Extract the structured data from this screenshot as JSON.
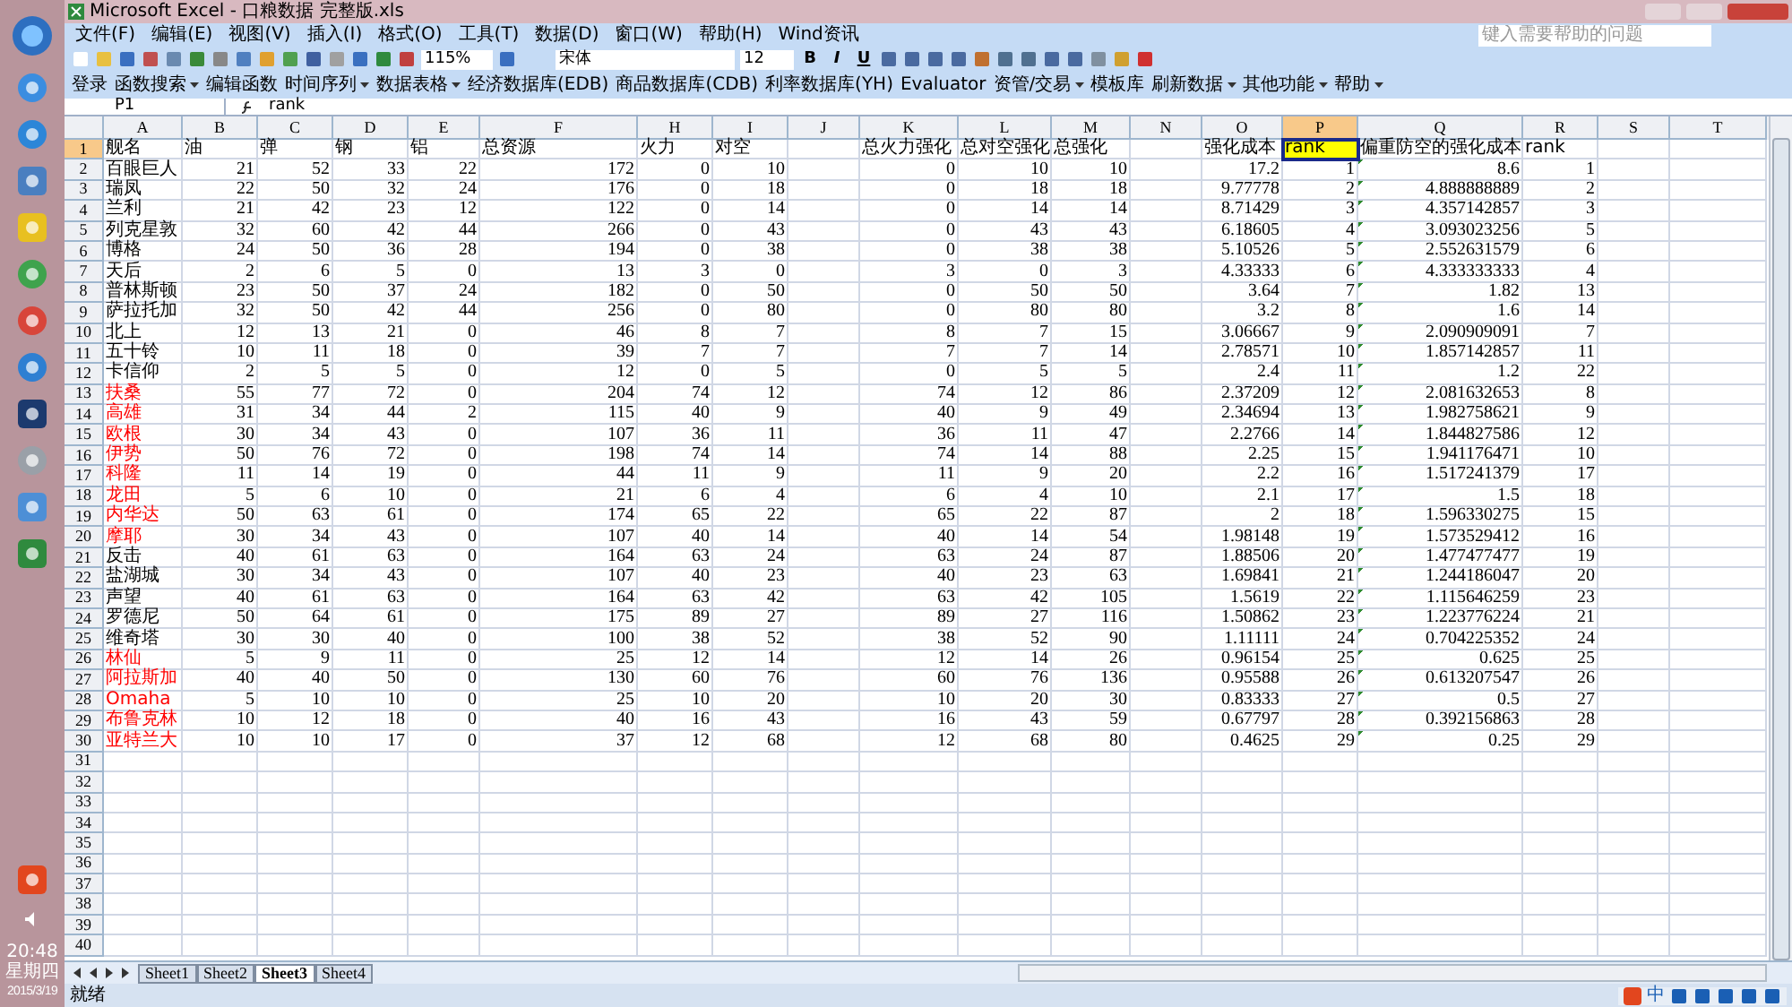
{
  "window": {
    "title": "Microsoft Excel - 口粮数据 完整版.xls"
  },
  "menu": [
    "文件(F)",
    "编辑(E)",
    "视图(V)",
    "插入(I)",
    "格式(O)",
    "工具(T)",
    "数据(D)",
    "窗口(W)",
    "帮助(H)",
    "Wind资讯"
  ],
  "help_field": {
    "placeholder": "键入需要帮助的问题"
  },
  "toolbar": {
    "zoom": "115%",
    "font": "宋体",
    "size": "12",
    "format_buttons": [
      "B",
      "I",
      "U"
    ]
  },
  "addin_toolbar": [
    {
      "label": "登录",
      "dropdown": false
    },
    {
      "label": "函数搜索",
      "dropdown": true
    },
    {
      "label": "编辑函数",
      "dropdown": false
    },
    {
      "label": "时间序列",
      "dropdown": true
    },
    {
      "label": "数据表格",
      "dropdown": true
    },
    {
      "label": "经济数据库(EDB)",
      "dropdown": false
    },
    {
      "label": "商品数据库(CDB)",
      "dropdown": false
    },
    {
      "label": "利率数据库(YH)",
      "dropdown": false
    },
    {
      "label": "Evaluator",
      "dropdown": false
    },
    {
      "label": "资管/交易",
      "dropdown": true
    },
    {
      "label": "模板库",
      "dropdown": false
    },
    {
      "label": "刷新数据",
      "dropdown": true
    },
    {
      "label": "其他功能",
      "dropdown": true
    },
    {
      "label": "帮助",
      "dropdown": true
    }
  ],
  "formula_bar": {
    "name_box": "P1",
    "value": "rank"
  },
  "columns": [
    {
      "letter": "A",
      "selected": false
    },
    {
      "letter": "B",
      "selected": false
    },
    {
      "letter": "C",
      "selected": false
    },
    {
      "letter": "D",
      "selected": false
    },
    {
      "letter": "E",
      "selected": false
    },
    {
      "letter": "F",
      "selected": false
    },
    {
      "letter": "H",
      "selected": false
    },
    {
      "letter": "I",
      "selected": false
    },
    {
      "letter": "J",
      "selected": false
    },
    {
      "letter": "K",
      "selected": false
    },
    {
      "letter": "L",
      "selected": false
    },
    {
      "letter": "M",
      "selected": false
    },
    {
      "letter": "N",
      "selected": false
    },
    {
      "letter": "O",
      "selected": false
    },
    {
      "letter": "P",
      "selected": true
    },
    {
      "letter": "Q",
      "selected": false
    },
    {
      "letter": "R",
      "selected": false
    },
    {
      "letter": "S",
      "selected": false
    },
    {
      "letter": "T",
      "selected": false
    }
  ],
  "rows": [
    {
      "number": "1",
      "selected": true,
      "cells": [
        "舰名",
        "油",
        "弹",
        "钢",
        "铝",
        "总资源",
        "火力",
        "对空",
        null,
        "总火力强化",
        "总对空强化",
        "总强化",
        null,
        "强化成本",
        "rank",
        "偏重防空的强化成本",
        "rank",
        null,
        null
      ]
    },
    {
      "number": "2",
      "selected": false,
      "color": "#000000",
      "flagged": true,
      "cells": [
        "百眼巨人",
        "21",
        "52",
        "33",
        "22",
        "172",
        "0",
        "10",
        null,
        "0",
        "10",
        "10",
        null,
        "17.2",
        "1",
        "8.6",
        "1",
        null,
        null
      ]
    },
    {
      "number": "3",
      "selected": false,
      "color": "#000000",
      "flagged": true,
      "cells": [
        "瑞凤",
        "22",
        "50",
        "32",
        "24",
        "176",
        "0",
        "18",
        null,
        "0",
        "18",
        "18",
        null,
        "9.77778",
        "2",
        "4.888888889",
        "2",
        null,
        null
      ]
    },
    {
      "number": "4",
      "selected": false,
      "color": "#000000",
      "flagged": true,
      "cells": [
        "兰利",
        "21",
        "42",
        "23",
        "12",
        "122",
        "0",
        "14",
        null,
        "0",
        "14",
        "14",
        null,
        "8.71429",
        "3",
        "4.357142857",
        "3",
        null,
        null
      ]
    },
    {
      "number": "5",
      "selected": false,
      "color": "#000000",
      "flagged": true,
      "cells": [
        "列克星敦",
        "32",
        "60",
        "42",
        "44",
        "266",
        "0",
        "43",
        null,
        "0",
        "43",
        "43",
        null,
        "6.18605",
        "4",
        "3.093023256",
        "5",
        null,
        null
      ]
    },
    {
      "number": "6",
      "selected": false,
      "color": "#000000",
      "flagged": true,
      "cells": [
        "博格",
        "24",
        "50",
        "36",
        "28",
        "194",
        "0",
        "38",
        null,
        "0",
        "38",
        "38",
        null,
        "5.10526",
        "5",
        "2.552631579",
        "6",
        null,
        null
      ]
    },
    {
      "number": "7",
      "selected": false,
      "color": "#000000",
      "flagged": true,
      "cells": [
        "天后",
        "2",
        "6",
        "5",
        "0",
        "13",
        "3",
        "0",
        null,
        "3",
        "0",
        "3",
        null,
        "4.33333",
        "6",
        "4.333333333",
        "4",
        null,
        null
      ]
    },
    {
      "number": "8",
      "selected": false,
      "color": "#000000",
      "flagged": true,
      "cells": [
        "普林斯顿",
        "23",
        "50",
        "37",
        "24",
        "182",
        "0",
        "50",
        null,
        "0",
        "50",
        "50",
        null,
        "3.64",
        "7",
        "1.82",
        "13",
        null,
        null
      ]
    },
    {
      "number": "9",
      "selected": false,
      "color": "#000000",
      "flagged": true,
      "cells": [
        "萨拉托加",
        "32",
        "50",
        "42",
        "44",
        "256",
        "0",
        "80",
        null,
        "0",
        "80",
        "80",
        null,
        "3.2",
        "8",
        "1.6",
        "14",
        null,
        null
      ]
    },
    {
      "number": "10",
      "selected": false,
      "color": "#000000",
      "flagged": true,
      "cells": [
        "北上",
        "12",
        "13",
        "21",
        "0",
        "46",
        "8",
        "7",
        null,
        "8",
        "7",
        "15",
        null,
        "3.06667",
        "9",
        "2.090909091",
        "7",
        null,
        null
      ]
    },
    {
      "number": "11",
      "selected": false,
      "color": "#000000",
      "flagged": true,
      "cells": [
        "五十铃",
        "10",
        "11",
        "18",
        "0",
        "39",
        "7",
        "7",
        null,
        "7",
        "7",
        "14",
        null,
        "2.78571",
        "10",
        "1.857142857",
        "11",
        null,
        null
      ]
    },
    {
      "number": "12",
      "selected": false,
      "color": "#000000",
      "flagged": true,
      "cells": [
        "卡信仰",
        "2",
        "5",
        "5",
        "0",
        "12",
        "0",
        "5",
        null,
        "0",
        "5",
        "5",
        null,
        "2.4",
        "11",
        "1.2",
        "22",
        null,
        null
      ]
    },
    {
      "number": "13",
      "selected": false,
      "color": "#ff0000",
      "flagged": true,
      "cells": [
        "扶桑",
        "55",
        "77",
        "72",
        "0",
        "204",
        "74",
        "12",
        null,
        "74",
        "12",
        "86",
        null,
        "2.37209",
        "12",
        "2.081632653",
        "8",
        null,
        null
      ]
    },
    {
      "number": "14",
      "selected": false,
      "color": "#ff0000",
      "flagged": true,
      "cells": [
        "高雄",
        "31",
        "34",
        "44",
        "2",
        "115",
        "40",
        "9",
        null,
        "40",
        "9",
        "49",
        null,
        "2.34694",
        "13",
        "1.982758621",
        "9",
        null,
        null
      ]
    },
    {
      "number": "15",
      "selected": false,
      "color": "#ff0000",
      "flagged": true,
      "cells": [
        "欧根",
        "30",
        "34",
        "43",
        "0",
        "107",
        "36",
        "11",
        null,
        "36",
        "11",
        "47",
        null,
        "2.2766",
        "14",
        "1.844827586",
        "12",
        null,
        null
      ]
    },
    {
      "number": "16",
      "selected": false,
      "color": "#ff0000",
      "flagged": true,
      "cells": [
        "伊势",
        "50",
        "76",
        "72",
        "0",
        "198",
        "74",
        "14",
        null,
        "74",
        "14",
        "88",
        null,
        "2.25",
        "15",
        "1.941176471",
        "10",
        null,
        null
      ]
    },
    {
      "number": "17",
      "selected": false,
      "color": "#ff0000",
      "flagged": true,
      "cells": [
        "科隆",
        "11",
        "14",
        "19",
        "0",
        "44",
        "11",
        "9",
        null,
        "11",
        "9",
        "20",
        null,
        "2.2",
        "16",
        "1.517241379",
        "17",
        null,
        null
      ]
    },
    {
      "number": "18",
      "selected": false,
      "color": "#ff0000",
      "flagged": true,
      "cells": [
        "龙田",
        "5",
        "6",
        "10",
        "0",
        "21",
        "6",
        "4",
        null,
        "6",
        "4",
        "10",
        null,
        "2.1",
        "17",
        "1.5",
        "18",
        null,
        null
      ]
    },
    {
      "number": "19",
      "selected": false,
      "color": "#ff0000",
      "flagged": true,
      "cells": [
        "内华达",
        "50",
        "63",
        "61",
        "0",
        "174",
        "65",
        "22",
        null,
        "65",
        "22",
        "87",
        null,
        "2",
        "18",
        "1.596330275",
        "15",
        null,
        null
      ]
    },
    {
      "number": "20",
      "selected": false,
      "color": "#ff0000",
      "flagged": true,
      "cells": [
        "摩耶",
        "30",
        "34",
        "43",
        "0",
        "107",
        "40",
        "14",
        null,
        "40",
        "14",
        "54",
        null,
        "1.98148",
        "19",
        "1.573529412",
        "16",
        null,
        null
      ]
    },
    {
      "number": "21",
      "selected": false,
      "color": "#000000",
      "flagged": true,
      "cells": [
        "反击",
        "40",
        "61",
        "63",
        "0",
        "164",
        "63",
        "24",
        null,
        "63",
        "24",
        "87",
        null,
        "1.88506",
        "20",
        "1.477477477",
        "19",
        null,
        null
      ]
    },
    {
      "number": "22",
      "selected": false,
      "color": "#000000",
      "flagged": true,
      "cells": [
        "盐湖城",
        "30",
        "34",
        "43",
        "0",
        "107",
        "40",
        "23",
        null,
        "40",
        "23",
        "63",
        null,
        "1.69841",
        "21",
        "1.244186047",
        "20",
        null,
        null
      ]
    },
    {
      "number": "23",
      "selected": false,
      "color": "#000000",
      "flagged": true,
      "cells": [
        "声望",
        "40",
        "61",
        "63",
        "0",
        "164",
        "63",
        "42",
        null,
        "63",
        "42",
        "105",
        null,
        "1.5619",
        "22",
        "1.115646259",
        "23",
        null,
        null
      ]
    },
    {
      "number": "24",
      "selected": false,
      "color": "#000000",
      "flagged": true,
      "cells": [
        "罗德尼",
        "50",
        "64",
        "61",
        "0",
        "175",
        "89",
        "27",
        null,
        "89",
        "27",
        "116",
        null,
        "1.50862",
        "23",
        "1.223776224",
        "21",
        null,
        null
      ]
    },
    {
      "number": "25",
      "selected": false,
      "color": "#000000",
      "flagged": true,
      "cells": [
        "维奇塔",
        "30",
        "30",
        "40",
        "0",
        "100",
        "38",
        "52",
        null,
        "38",
        "52",
        "90",
        null,
        "1.11111",
        "24",
        "0.704225352",
        "24",
        null,
        null
      ]
    },
    {
      "number": "26",
      "selected": false,
      "color": "#ff0000",
      "flagged": true,
      "cells": [
        "林仙",
        "5",
        "9",
        "11",
        "0",
        "25",
        "12",
        "14",
        null,
        "12",
        "14",
        "26",
        null,
        "0.96154",
        "25",
        "0.625",
        "25",
        null,
        null
      ]
    },
    {
      "number": "27",
      "selected": false,
      "color": "#ff0000",
      "flagged": true,
      "cells": [
        "阿拉斯加",
        "40",
        "40",
        "50",
        "0",
        "130",
        "60",
        "76",
        null,
        "60",
        "76",
        "136",
        null,
        "0.95588",
        "26",
        "0.613207547",
        "26",
        null,
        null
      ]
    },
    {
      "number": "28",
      "selected": false,
      "color": "#ff0000",
      "flagged": true,
      "cells": [
        "Omaha",
        "5",
        "10",
        "10",
        "0",
        "25",
        "10",
        "20",
        null,
        "10",
        "20",
        "30",
        null,
        "0.83333",
        "27",
        "0.5",
        "27",
        null,
        null
      ]
    },
    {
      "number": "29",
      "selected": false,
      "color": "#ff0000",
      "flagged": true,
      "cells": [
        "布鲁克林",
        "10",
        "12",
        "18",
        "0",
        "40",
        "16",
        "43",
        null,
        "16",
        "43",
        "59",
        null,
        "0.67797",
        "28",
        "0.392156863",
        "28",
        null,
        null
      ]
    },
    {
      "number": "30",
      "selected": false,
      "color": "#ff0000",
      "flagged": true,
      "cells": [
        "亚特兰大",
        "10",
        "10",
        "17",
        "0",
        "37",
        "12",
        "68",
        null,
        "12",
        "68",
        "80",
        null,
        "0.4625",
        "29",
        "0.25",
        "29",
        null,
        null
      ]
    },
    {
      "number": "31",
      "selected": false
    },
    {
      "number": "32",
      "selected": false
    },
    {
      "number": "33",
      "selected": false
    },
    {
      "number": "34",
      "selected": false
    },
    {
      "number": "35",
      "selected": false
    },
    {
      "number": "36",
      "selected": false
    },
    {
      "number": "37",
      "selected": false
    },
    {
      "number": "38",
      "selected": false
    },
    {
      "number": "39",
      "selected": false
    },
    {
      "number": "40",
      "selected": false
    }
  ],
  "sheet_tabs": [
    {
      "label": "Sheet1",
      "selected": false
    },
    {
      "label": "Sheet2",
      "selected": false
    },
    {
      "label": "Sheet3",
      "selected": true
    },
    {
      "label": "Sheet4",
      "selected": false
    }
  ],
  "status_bar": "就绪",
  "ime_bar": "中",
  "clock": {
    "time": "20:48",
    "weekday": "星期四",
    "date": "2015/3/19"
  }
}
